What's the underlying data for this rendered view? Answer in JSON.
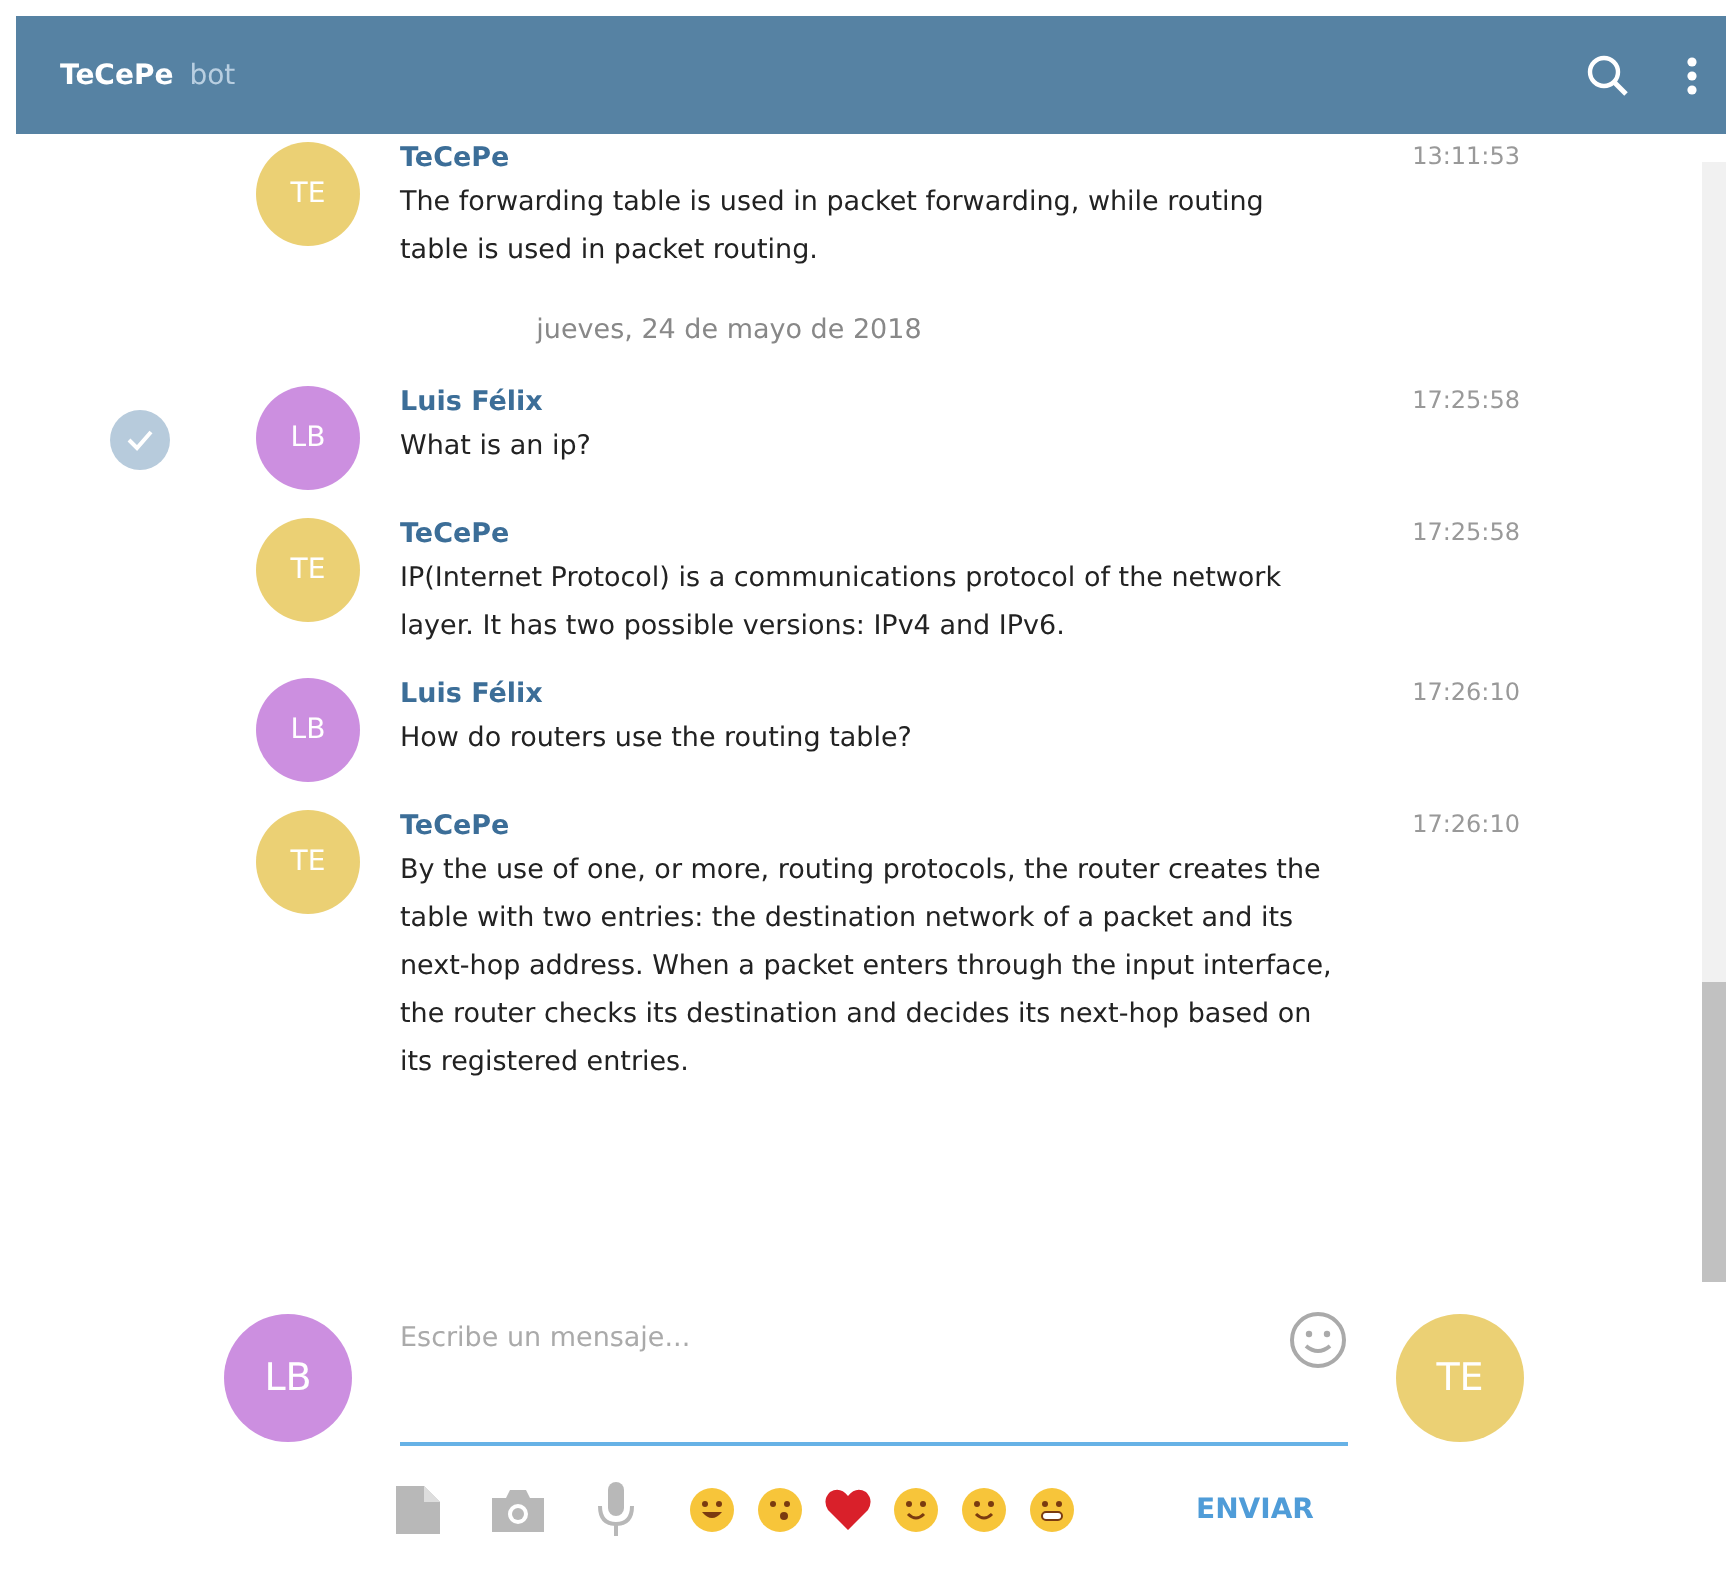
{
  "header": {
    "title": "TeCePe",
    "subtitle": "bot"
  },
  "messages": [
    {
      "kind": "message",
      "sender": "TeCePe",
      "initials": "TE",
      "color": "#ebd074",
      "time": "13:11:53",
      "text": "The forwarding table is used in packet forwarding, while routing table is used in packet routing.",
      "selected": false
    },
    {
      "kind": "date",
      "text": "jueves, 24 de mayo de 2018"
    },
    {
      "kind": "message",
      "sender": "Luis Félix",
      "initials": "LB",
      "color": "#cc8fe0",
      "time": "17:25:58",
      "text": "What is an ip?",
      "selected": true
    },
    {
      "kind": "message",
      "sender": "TeCePe",
      "initials": "TE",
      "color": "#ebd074",
      "time": "17:25:58",
      "text": "IP(Internet Protocol) is a communications protocol of the network layer. It has two possible versions: IPv4 and IPv6.",
      "selected": false
    },
    {
      "kind": "message",
      "sender": "Luis Félix",
      "initials": "LB",
      "color": "#cc8fe0",
      "time": "17:26:10",
      "text": "How do routers use the routing table?",
      "selected": false
    },
    {
      "kind": "message",
      "sender": "TeCePe",
      "initials": "TE",
      "color": "#ebd074",
      "time": "17:26:10",
      "text": "By the use of one, or more, routing protocols, the router creates the table with two entries: the destination network of a packet and its next-hop address. When a packet enters through the input interface, the router checks its destination and decides its next-hop based on its registered entries.",
      "selected": false
    }
  ],
  "composer": {
    "placeholder": "Escribe un mensaje...",
    "avatars": [
      {
        "initials": "LB",
        "color": "#cc8fe0"
      },
      {
        "initials": "TE",
        "color": "#ebd074"
      }
    ],
    "send": "ENVIAR"
  }
}
